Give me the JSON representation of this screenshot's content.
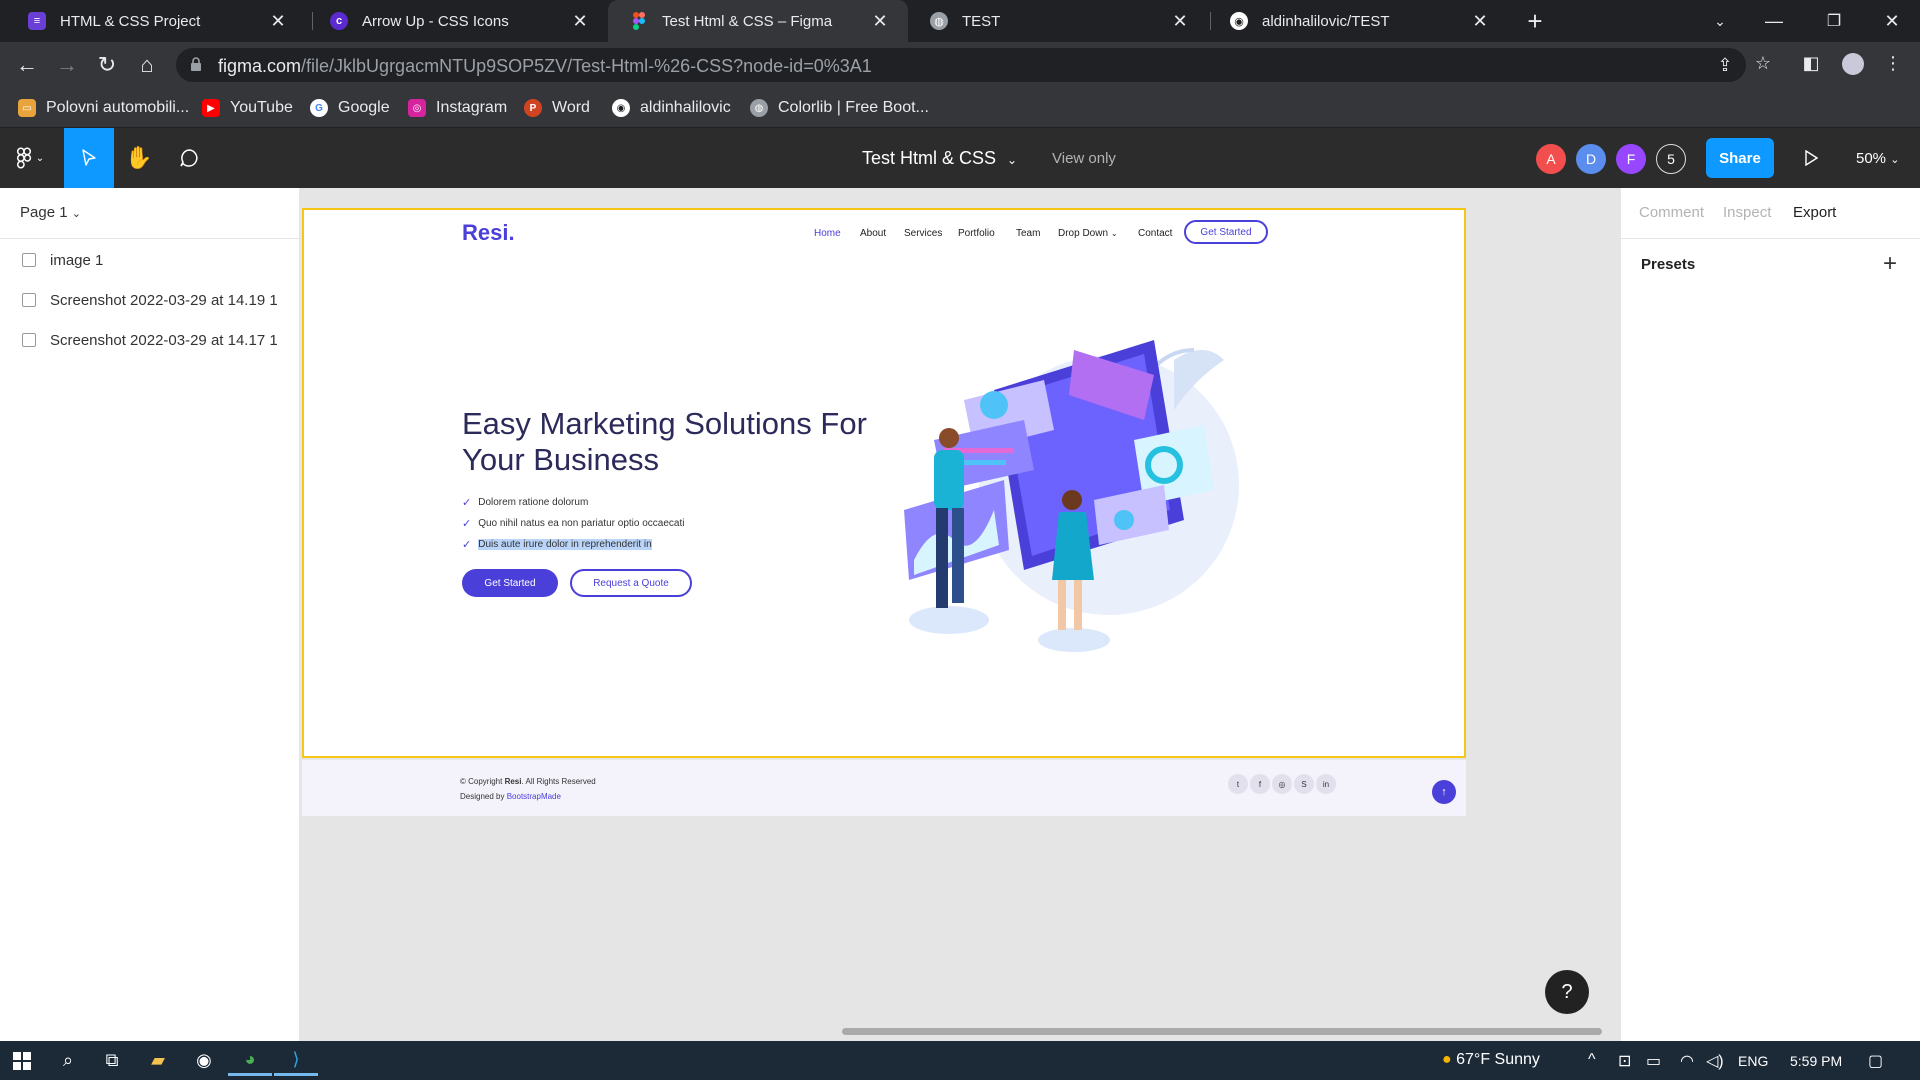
{
  "browser": {
    "tabs": [
      {
        "label": "HTML & CSS Project",
        "active": false,
        "icon": "list-icon",
        "color": "#6a3fd6"
      },
      {
        "label": "Arrow Up - CSS Icons",
        "active": false,
        "icon": "c-logo-icon",
        "color": "#5b2bd1"
      },
      {
        "label": "Test Html & CSS – Figma",
        "active": true,
        "icon": "figma-icon",
        "color": "#f24e1e"
      },
      {
        "label": "TEST",
        "active": false,
        "icon": "globe-icon",
        "color": "#9aa0a6"
      },
      {
        "label": "aldinhalilovic/TEST",
        "active": false,
        "icon": "github-icon",
        "color": "#ffffff"
      }
    ],
    "url_host": "figma.com",
    "url_path": "/file/JklbUgrgacmNTUp9SOP5ZV/Test-Html-%26-CSS?node-id=0%3A1",
    "bookmarks": [
      {
        "label": "Polovni automobili...",
        "icon": "car-icon",
        "color": "#e8a33d"
      },
      {
        "label": "YouTube",
        "icon": "youtube-icon",
        "color": "#ff0000"
      },
      {
        "label": "Google",
        "icon": "google-icon",
        "color": "#4285f4"
      },
      {
        "label": "Instagram",
        "icon": "instagram-icon",
        "color": "#d6249f"
      },
      {
        "label": "Word",
        "icon": "word-icon",
        "color": "#d04423"
      },
      {
        "label": "aldinhalilovic",
        "icon": "github-icon",
        "color": "#ffffff"
      },
      {
        "label": "Colorlib | Free Boot...",
        "icon": "globe-icon",
        "color": "#9aa0a6"
      }
    ]
  },
  "figma": {
    "file_title": "Test Html & CSS",
    "view_only": "View only",
    "avatars": [
      {
        "initial": "A",
        "color": "#f24e4e"
      },
      {
        "initial": "D",
        "color": "#5b8def"
      },
      {
        "initial": "F",
        "color": "#9747ff"
      }
    ],
    "extra_users": "5",
    "share": "Share",
    "zoom": "50%",
    "page": "Page 1",
    "layers": [
      "image 1",
      "Screenshot 2022-03-29 at 14.19 1",
      "Screenshot 2022-03-29 at 14.17 1"
    ],
    "right_tabs": [
      "Comment",
      "Inspect",
      "Export"
    ],
    "active_right_tab": "Export",
    "presets": "Presets",
    "help": "?"
  },
  "site": {
    "logo": "Resi.",
    "nav": [
      "Home",
      "About",
      "Services",
      "Portfolio",
      "Team",
      "Drop Down",
      "Contact"
    ],
    "nav_cta": "Get Started",
    "hero_title": "Easy Marketing Solutions For Your Business",
    "checks": [
      "Dolorem ratione dolorum",
      "Quo nihil natus ea non pariatur optio occaecati",
      "Duis aute irure dolor in reprehenderit in"
    ],
    "btn_primary": "Get Started",
    "btn_secondary": "Request a Quote",
    "copyright_prefix": "© Copyright ",
    "copyright_brand": "Resi",
    "copyright_suffix": ". All Rights Reserved",
    "designed_by": "Designed by ",
    "designer": "BootstrapMade",
    "accent": "#4b3fd9"
  },
  "taskbar": {
    "weather": "67°F  Sunny",
    "lang": "ENG",
    "time": "5:59 PM"
  }
}
